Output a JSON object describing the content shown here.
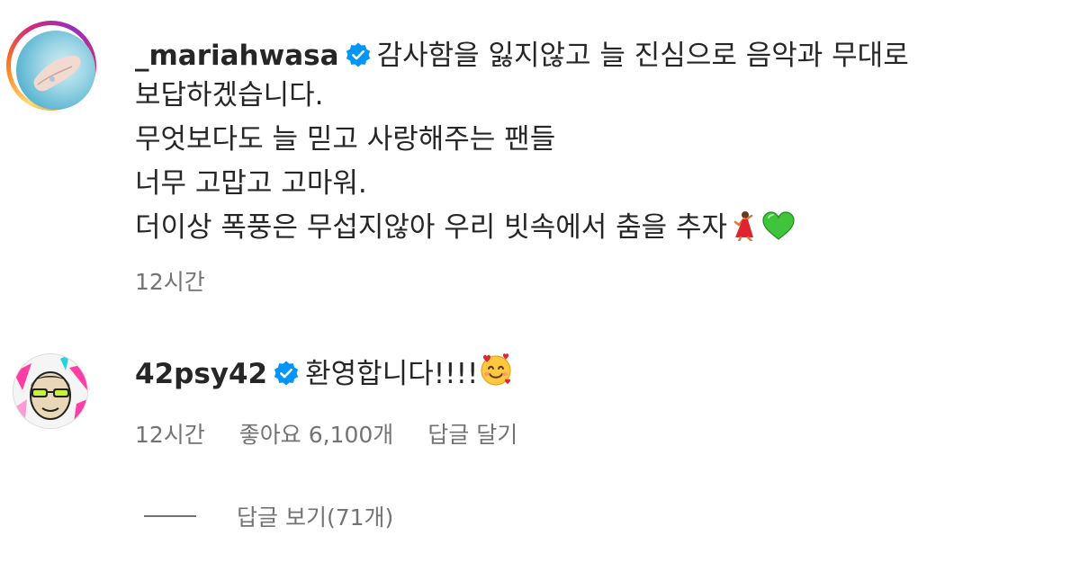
{
  "comments": [
    {
      "username": "_mariahwasa",
      "verified": true,
      "avatar_icon": "user-avatar",
      "lines": [
        "감사함을 잃지않고 늘 진심으로 음악과 무대로",
        "보답하겠습니다.",
        "무엇보다도 늘 믿고 사랑해주는 팬들",
        "너무 고맙고 고마워.",
        "더이상 폭풍은 무섭지않아 우리 빗속에서 춤을 추자"
      ],
      "emojis": [
        "dancer-emoji",
        "green-heart-emoji"
      ],
      "time": "12시간"
    },
    {
      "username": "42psy42",
      "verified": true,
      "avatar_icon": "user-avatar",
      "text": "환영합니다!!!!",
      "emojis": [
        "smiling-face-with-hearts-emoji"
      ],
      "time": "12시간",
      "likes": "좋아요 6,100개",
      "reply_label": "답글 달기",
      "view_replies": "답글 보기(71개)"
    }
  ],
  "colors": {
    "verified": "#0095f6",
    "meta_text": "#737373",
    "primary_text": "#262626"
  }
}
